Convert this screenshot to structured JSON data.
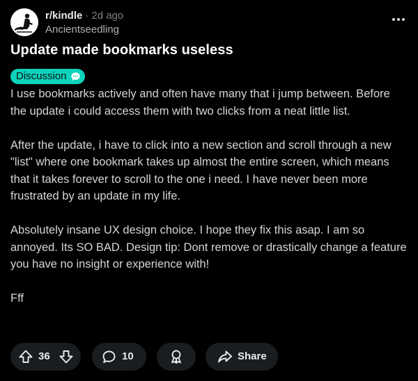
{
  "post": {
    "subreddit": "r/kindle",
    "separator": "·",
    "age": "2d ago",
    "author": "Ancientseedling",
    "title": "Update made bookmarks useless",
    "flair": "Discussion",
    "body": [
      "I use bookmarks actively and often have many that i jump between. Before the update i could access them with two clicks from a neat little list.",
      "After the update, i have to click into a new section and scroll through a new \"list\" where one bookmark takes up almost the entire screen, which means that it takes forever to scroll to the one i need. I have never been more frustrated by an update in my life.",
      "Absolutely insane UX design choice. I hope they fix this asap. I am so annoyed. Its SO BAD. Design tip: Dont remove or drastically change a feature you have no insight or experience with!",
      "Fff"
    ]
  },
  "actions": {
    "score": "36",
    "comments": "10",
    "share_label": "Share"
  },
  "icons": {
    "menu": "more-options-icon",
    "upvote": "upvote-arrow-icon",
    "downvote": "downvote-arrow-icon",
    "comment": "comment-bubble-icon",
    "award": "award-icon",
    "share": "share-arrow-icon",
    "flair": "speech-bubble-icon"
  },
  "colors": {
    "background": "#000000",
    "flair": "#0dd3bb",
    "pill": "#1a1d1f",
    "muted": "#7c7f82"
  }
}
